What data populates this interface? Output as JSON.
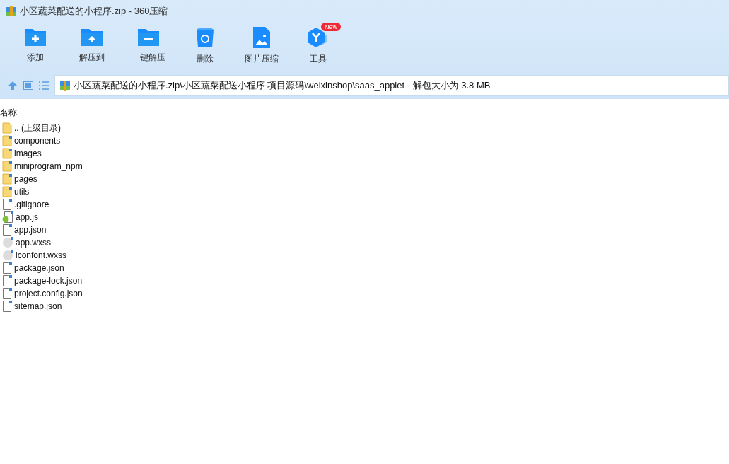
{
  "window": {
    "title": "小区蔬菜配送的小程序.zip - 360压缩"
  },
  "toolbar": [
    {
      "kind": "add",
      "label": "添加"
    },
    {
      "kind": "extract",
      "label": "解压到"
    },
    {
      "kind": "quick",
      "label": "一键解压"
    },
    {
      "kind": "delete",
      "label": "删除"
    },
    {
      "kind": "image",
      "label": "图片压缩"
    },
    {
      "kind": "tools",
      "label": "工具",
      "badge": "New"
    }
  ],
  "address": {
    "path": "小区蔬菜配送的小程序.zip\\小区蔬菜配送小程序 项目源码\\weixinshop\\saas_applet - 解包大小为 3.8 MB"
  },
  "table": {
    "columns": [
      "名称"
    ],
    "rows": [
      {
        "kind": "parent",
        "name": ".. (上级目录)"
      },
      {
        "kind": "folder",
        "name": "components"
      },
      {
        "kind": "folder",
        "name": "images"
      },
      {
        "kind": "folder",
        "name": "miniprogram_npm"
      },
      {
        "kind": "folder",
        "name": "pages"
      },
      {
        "kind": "folder",
        "name": "utils"
      },
      {
        "kind": "file",
        "name": ".gitignore"
      },
      {
        "kind": "script",
        "name": "app.js"
      },
      {
        "kind": "file",
        "name": "app.json"
      },
      {
        "kind": "style",
        "name": "app.wxss"
      },
      {
        "kind": "style",
        "name": "iconfont.wxss"
      },
      {
        "kind": "file",
        "name": "package.json"
      },
      {
        "kind": "file",
        "name": "package-lock.json"
      },
      {
        "kind": "file",
        "name": "project.config.json"
      },
      {
        "kind": "file",
        "name": "sitemap.json"
      }
    ]
  }
}
